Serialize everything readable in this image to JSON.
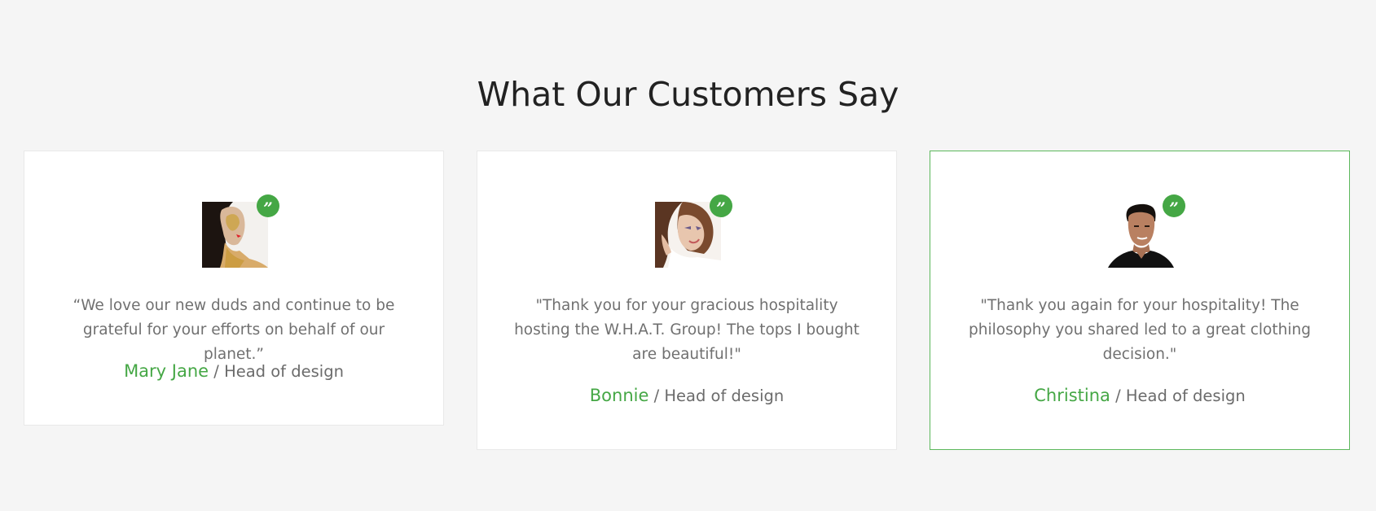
{
  "section": {
    "title": "What Our Customers Say"
  },
  "colors": {
    "accent": "#45a745",
    "background": "#f5f5f5",
    "card": "#ffffff",
    "active_border": "#5cb85c"
  },
  "testimonials": [
    {
      "quote": "“We love our new duds and continue to be grateful for your efforts on behalf of our planet.”",
      "name": "Mary Jane",
      "separator": "/",
      "role": "Head of design",
      "badge_icon": "quote-icon",
      "avatar": "woman-gold-paint-photo"
    },
    {
      "quote": "\"Thank you for your gracious hospitality hosting the W.H.A.T. Group! The tops I bought are beautiful!\"",
      "name": "Bonnie",
      "separator": "/",
      "role": "Head of design",
      "badge_icon": "quote-icon",
      "avatar": "woman-smiling-photo"
    },
    {
      "quote": "\"Thank you again for your hospitality! The philosophy you shared led to a great clothing decision.\"",
      "name": "Christina",
      "separator": "/",
      "role": "Head of design",
      "badge_icon": "quote-icon",
      "avatar": "man-black-shirt-photo"
    }
  ],
  "badge": {
    "glyph": "”"
  }
}
